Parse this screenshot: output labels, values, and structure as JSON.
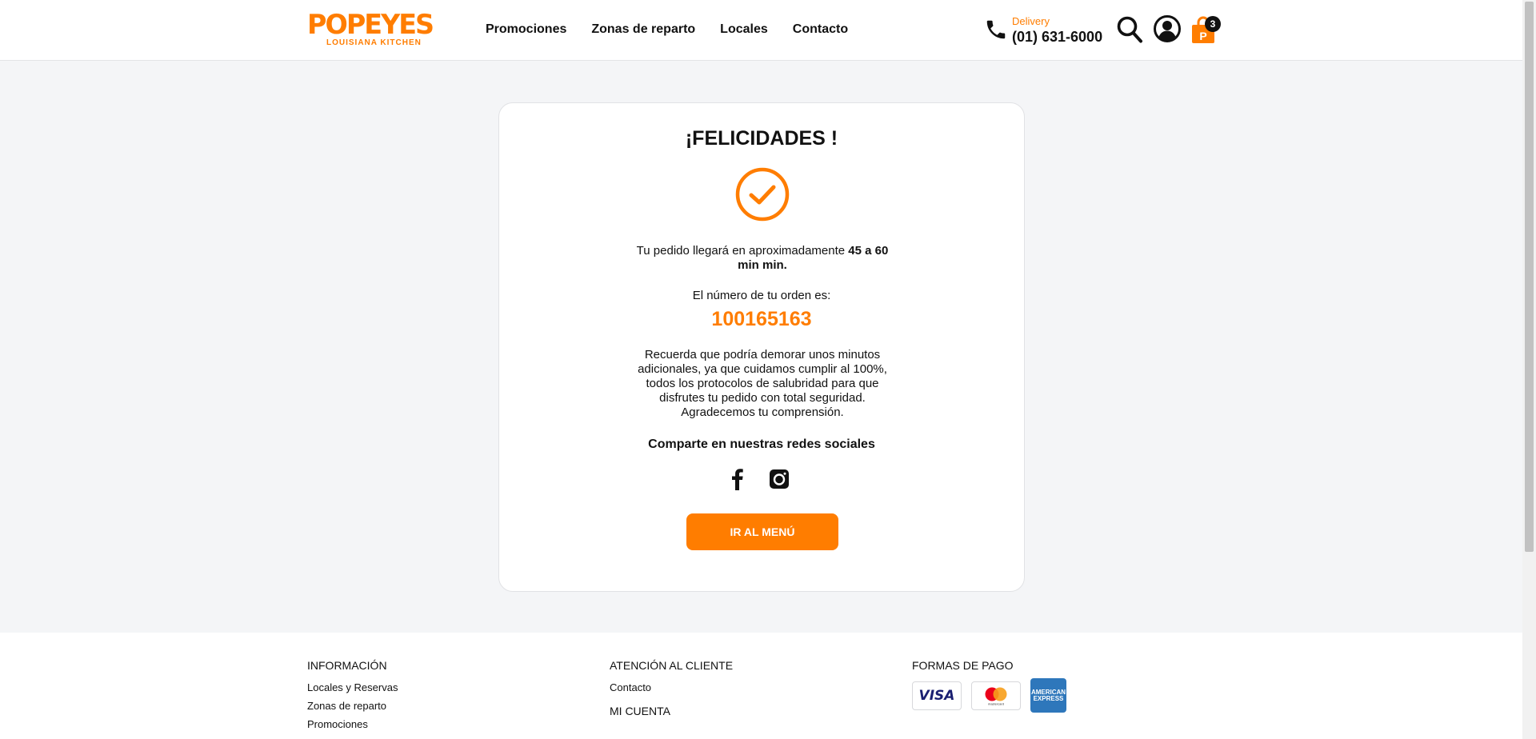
{
  "brand": {
    "name": "POPEYES",
    "tagline": "LOUISIANA KITCHEN",
    "accent": "#ff7d00"
  },
  "nav": {
    "items": [
      "Promociones",
      "Zonas de reparto",
      "Locales",
      "Contacto"
    ]
  },
  "delivery": {
    "label": "Delivery",
    "phone": "(01) 631-6000"
  },
  "header_icons": {
    "search": "search-icon",
    "user": "user-account-icon",
    "cart": "shopping-bag-icon",
    "cart_count": "3"
  },
  "confirmation": {
    "title": "¡FELICIDADES !",
    "status_icon": "check-circle-icon",
    "eta_prefix": "Tu pedido llegará en aproximadamente ",
    "eta_value": "45 a 60 min min.",
    "order_label": "El número de tu orden es:",
    "order_number": "100165163",
    "reminder": "Recuerda que podría demorar unos minutos adicionales, ya que cuidamos cumplir al 100%, todos los protocolos de salubridad para que disfrutes tu pedido con total seguridad. Agradecemos tu comprensión.",
    "share_heading": "Comparte en nuestras redes sociales",
    "social": [
      "facebook-icon",
      "instagram-icon"
    ],
    "cta_label": "IR AL MENÚ"
  },
  "footer": {
    "info": {
      "heading": "INFORMACIÓN",
      "links": [
        "Locales y Reservas",
        "Zonas de reparto",
        "Promociones"
      ]
    },
    "customer": {
      "heading": "ATENCIÓN AL CLIENTE",
      "links": [
        "Contacto"
      ],
      "account_heading": "MI CUENTA"
    },
    "payments": {
      "heading": "FORMAS DE PAGO",
      "methods": [
        "VISA",
        "mastercard",
        "AMERICAN EXPRESS"
      ]
    }
  }
}
